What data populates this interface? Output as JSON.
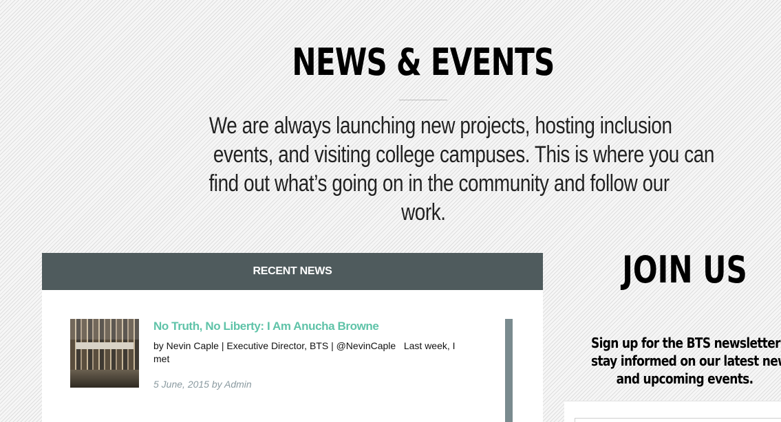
{
  "page": {
    "title": "NEWS & EVENTS",
    "intro_lines": [
      "We are always launching new projects, hosting inclusion",
      "events, and visiting college campuses. This is where you can",
      "find out what’s going on in the community and follow our",
      "work."
    ]
  },
  "recent_news": {
    "header": "RECENT NEWS",
    "items": [
      {
        "title": "No Truth, No Liberty: I Am Anucha Browne",
        "excerpt": "by Nevin Caple | Executive Director, BTS | @NevinCaple   Last week, I met",
        "meta": "5 June, 2015 by Admin",
        "thumbnail": "building-photo"
      }
    ]
  },
  "join": {
    "title": "JOIN US",
    "text_lines": [
      "Sign up for the BTS newsletter t",
      "stay informed on our latest new",
      "and upcoming events."
    ]
  },
  "colors": {
    "accent_green": "#5fc3a8",
    "header_slate": "#4f5b5d",
    "meta_gray": "#8a9aa0"
  }
}
